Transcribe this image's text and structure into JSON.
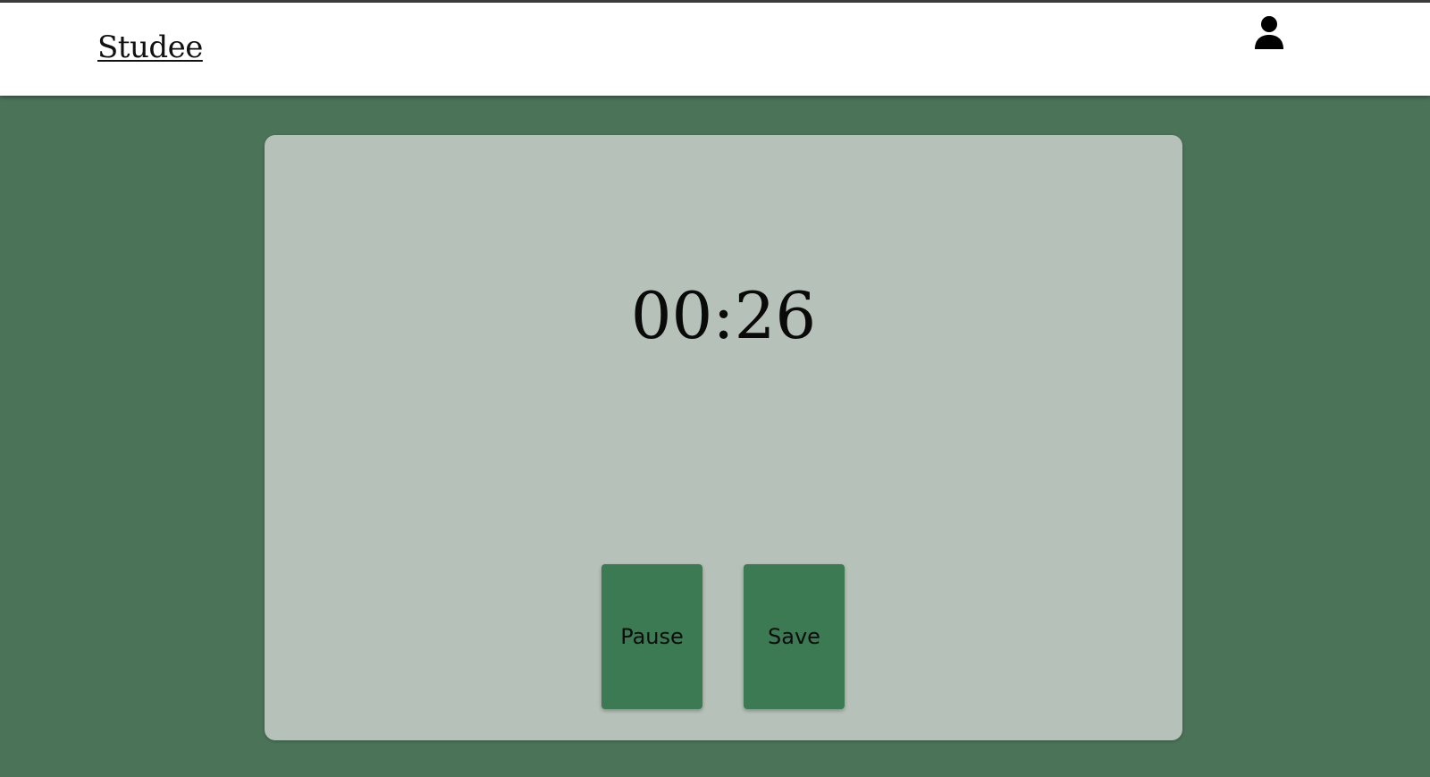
{
  "header": {
    "brand": "Studee",
    "user_icon": "user-icon"
  },
  "timer": {
    "display": "00:26"
  },
  "controls": {
    "pause_label": "Pause",
    "save_label": "Save"
  },
  "colors": {
    "background": "#4a7358",
    "card": "#b6c2b9",
    "button": "#3c7a54",
    "navbar": "#ffffff"
  }
}
